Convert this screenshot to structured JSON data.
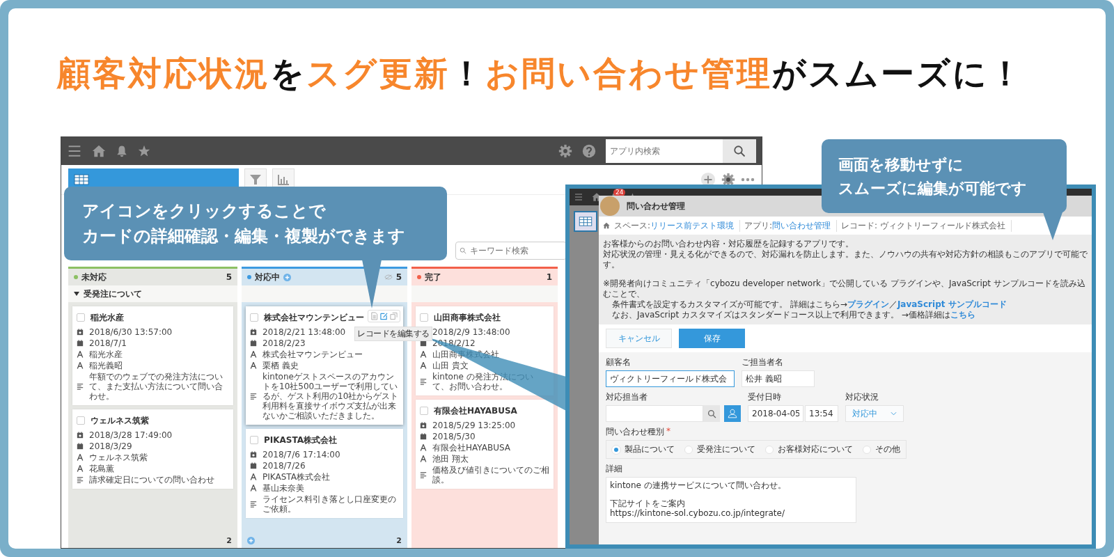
{
  "headline": [
    {
      "text": "顧客対応状況",
      "highlight": true
    },
    {
      "text": "を",
      "highlight": false
    },
    {
      "text": "スグ更新",
      "highlight": true
    },
    {
      "text": "！",
      "highlight": false
    },
    {
      "text": "お問い合わせ管理",
      "highlight": true
    },
    {
      "text": "がスムーズに！",
      "highlight": false
    }
  ],
  "main_app": {
    "search": {
      "placeholder": "アプリ内検索"
    },
    "keyword_search": {
      "placeholder": "キーワード検索"
    },
    "tooltip": "レコードを編集する",
    "columns": [
      {
        "title": "未対応",
        "color": "#8cc063",
        "count": "5",
        "add": false,
        "hidden_icon": false,
        "group": "受発注について",
        "footer_count": "2",
        "cards": [
          {
            "title": "稲光水産",
            "checked": false,
            "hovered": false,
            "rows": [
              {
                "kind": "datetime",
                "value": "2018/6/30 13:57:00"
              },
              {
                "kind": "date",
                "value": "2018/7/1"
              },
              {
                "kind": "text",
                "value": "稲光水産"
              },
              {
                "kind": "text",
                "value": "稲光義昭"
              },
              {
                "kind": "note",
                "value": "年額でのウェブでの発注方法について、また支払い方法について問い合わせ。"
              }
            ]
          },
          {
            "title": "ウェルネス筑紫",
            "checked": false,
            "hovered": false,
            "rows": [
              {
                "kind": "datetime",
                "value": "2018/3/28 17:49:00"
              },
              {
                "kind": "date",
                "value": "2018/3/29"
              },
              {
                "kind": "text",
                "value": "ウェルネス筑紫"
              },
              {
                "kind": "text",
                "value": "花島薫"
              },
              {
                "kind": "note",
                "value": "請求確定日についての問い合わせ"
              }
            ]
          }
        ]
      },
      {
        "title": "対応中",
        "color": "#3d9ae0",
        "count": "5",
        "add": true,
        "hidden_icon": true,
        "footer_count": "2",
        "cards": [
          {
            "title": "株式会社マウンテンビュー",
            "checked": false,
            "hovered": true,
            "rows": [
              {
                "kind": "datetime",
                "value": "2018/2/21 13:48:00"
              },
              {
                "kind": "date",
                "value": "2018/2/23"
              },
              {
                "kind": "text",
                "value": "株式会社マウンテンビュー"
              },
              {
                "kind": "text",
                "value": "栗栖 義史"
              },
              {
                "kind": "note",
                "value": "kintoneゲストスペースのアカウントを10社500ユーザーで利用しているが、ゲスト利用の10社からゲスト利用料を直接サイボウズ支払が出来ないかご相談いただきました。"
              }
            ]
          },
          {
            "title": "PIKASTA株式会社",
            "checked": false,
            "hovered": false,
            "rows": [
              {
                "kind": "datetime",
                "value": "2018/7/6 17:14:00"
              },
              {
                "kind": "date",
                "value": "2018/7/26"
              },
              {
                "kind": "text",
                "value": "PIKASTA株式会社"
              },
              {
                "kind": "text",
                "value": "基山未奈美"
              },
              {
                "kind": "note",
                "value": "ライセンス料引き落とし口座変更のご依頼。"
              }
            ]
          }
        ]
      },
      {
        "title": "完了",
        "color": "#f2604a",
        "count": "1",
        "add": false,
        "hidden_icon": false,
        "cards": [
          {
            "title": "山田商事株式会社",
            "checked": false,
            "hovered": false,
            "rows": [
              {
                "kind": "datetime",
                "value": "2018/2/9 13:48:00"
              },
              {
                "kind": "date",
                "value": "2018/2/12"
              },
              {
                "kind": "text",
                "value": "山田商事株式会社"
              },
              {
                "kind": "text",
                "value": "山田 貴文"
              },
              {
                "kind": "note",
                "value": "kintone の発注方法について、お問い合わせ。"
              }
            ]
          },
          {
            "title": "有限会社HAYABUSA",
            "checked": false,
            "hovered": false,
            "rows": [
              {
                "kind": "datetime",
                "value": "2018/5/29 13:25:00"
              },
              {
                "kind": "date",
                "value": "2018/5/30"
              },
              {
                "kind": "text",
                "value": "有限会社HAYABUSA"
              },
              {
                "kind": "text",
                "value": "池田 翔太"
              },
              {
                "kind": "note",
                "value": "価格及び値引きについてのご相談。"
              }
            ]
          }
        ]
      }
    ]
  },
  "edit_window": {
    "notification_count": "24",
    "app_title": "問い合わせ管理",
    "breadcrumbs": [
      {
        "label": "スペース: ",
        "link": "リリース前テスト環境"
      },
      {
        "label": "アプリ: ",
        "link": "問い合わせ管理"
      },
      {
        "label": "レコード: ヴィクトリーフィールド株式会社"
      }
    ],
    "description": [
      [
        [
          {
            "text": "お客様からのお問い合わせ内容・対応履歴を記録するアプリです。",
            "link": false
          }
        ],
        [
          {
            "text": "対応状況の管理・見える化ができるので、対応漏れを防止します。また、ノウハウの共有や対応方針の相談もこのアプリで可能です。",
            "link": false
          }
        ]
      ],
      [
        [
          {
            "text": "※開発者向けコミュニティ「cybozu developer network」で公開している プラグインや、JavaScript サンプルコードを読み込むことで、",
            "link": false
          }
        ],
        [
          {
            "text": "条件書式を設定するカスタマイズが可能です。 詳細はこちら→",
            "link": false
          },
          {
            "text": "プラグイン",
            "link": true
          },
          {
            "text": "／",
            "link": false
          },
          {
            "text": "JavaScript サンプルコード",
            "link": true
          }
        ],
        [
          {
            "text": "なお、JavaScript カスタマイズはスタンダードコース以上で利用できます。 →価格詳細は",
            "link": false
          },
          {
            "text": "こちら",
            "link": true
          }
        ]
      ]
    ],
    "cancel": "キャンセル",
    "save": "保存",
    "customer": {
      "label": "顧客名",
      "value": "ヴィクトリーフィールド株式会",
      "focused": true
    },
    "contact": {
      "label": "ご担当者名",
      "value": "松井 義昭",
      "focused": false
    },
    "assignee": {
      "label": "対応担当者"
    },
    "received": {
      "label": "受付日時",
      "date": "2018-04-05",
      "time": "13:54"
    },
    "status": {
      "label": "対応状況",
      "value": "対応中"
    },
    "inquiry_type": {
      "label": "問い合わせ種別",
      "required_mark": "*",
      "options": [
        {
          "label": "製品について",
          "selected": true
        },
        {
          "label": "受発注について",
          "selected": false
        },
        {
          "label": "お客様対応について",
          "selected": false
        },
        {
          "label": "その他",
          "selected": false
        }
      ]
    },
    "details": {
      "label": "詳細",
      "paragraphs": [
        [
          "kintone の連携サービスについて問い合わせ。"
        ],
        [
          "下記サイトをご案内",
          "https://kintone-sol.cybozu.co.jp/integrate/"
        ]
      ]
    }
  },
  "callouts": [
    {
      "lines": [
        "アイコンをクリックすることで",
        "カードの詳細確認・編集・複製ができます"
      ]
    },
    {
      "lines": [
        "画面を移動せずに",
        "スムーズに編集が可能です"
      ]
    }
  ]
}
